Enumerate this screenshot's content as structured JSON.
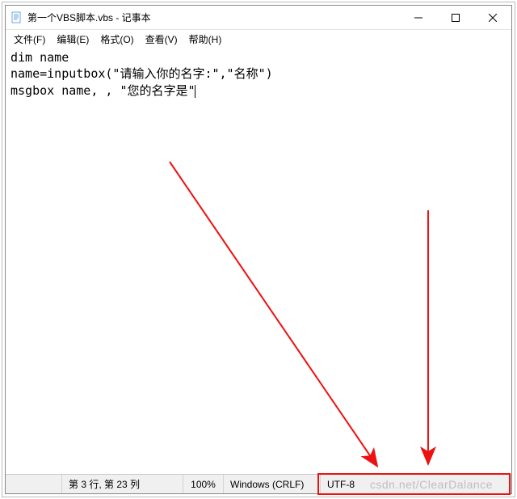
{
  "titlebar": {
    "title": "第一个VBS脚本.vbs - 记事本"
  },
  "menus": {
    "file": "文件(F)",
    "edit": "编辑(E)",
    "format": "格式(O)",
    "view": "查看(V)",
    "help": "帮助(H)"
  },
  "editor": {
    "content": "dim name\nname=inputbox(\"请输入你的名字:\",\"名称\")\nmsgbox name, , \"您的名字是\""
  },
  "status": {
    "position": "第 3 行, 第 23 列",
    "zoom": "100%",
    "eol": "Windows (CRLF)",
    "encoding": "UTF-8"
  },
  "watermark": "csdn.net/ClearDalance"
}
